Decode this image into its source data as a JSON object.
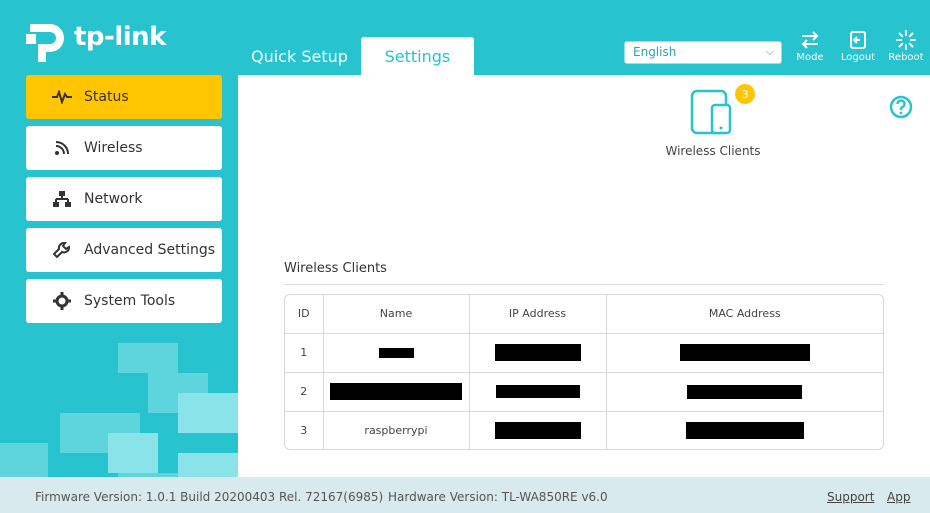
{
  "brand": {
    "name": "tp-link"
  },
  "tabs": [
    {
      "label": "Quick Setup"
    },
    {
      "label": "Settings"
    }
  ],
  "language": {
    "selected": "English"
  },
  "toolbar": {
    "mode_label": "Mode",
    "logout_label": "Logout",
    "reboot_label": "Reboot"
  },
  "sidebar": {
    "items": [
      {
        "label": "Status",
        "icon": "pulse-icon",
        "active": true
      },
      {
        "label": "Wireless",
        "icon": "wifi-icon"
      },
      {
        "label": "Network",
        "icon": "network-icon"
      },
      {
        "label": "Advanced Settings",
        "icon": "wrench-icon"
      },
      {
        "label": "System Tools",
        "icon": "gear-icon"
      }
    ]
  },
  "status": {
    "wireless_clients_label": "Wireless Clients",
    "client_count": "3"
  },
  "clients_table": {
    "title": "Wireless Clients",
    "columns": [
      "ID",
      "Name",
      "IP Address",
      "MAC Address"
    ],
    "rows": [
      {
        "id": "1",
        "name": "",
        "ip": "",
        "mac": ""
      },
      {
        "id": "2",
        "name": "",
        "ip": "",
        "mac": ""
      },
      {
        "id": "3",
        "name": "raspberrypi",
        "ip": "",
        "mac": ""
      }
    ]
  },
  "footer": {
    "firmware": "Firmware Version: 1.0.1 Build 20200403 Rel. 72167(6985)",
    "hardware": "Hardware Version: TL-WA850RE v6.0",
    "support_label": "Support",
    "app_label": "App"
  },
  "colors": {
    "accent": "#27c3cf",
    "active_menu": "#ffc600",
    "footer_bg": "#d8eaed"
  }
}
